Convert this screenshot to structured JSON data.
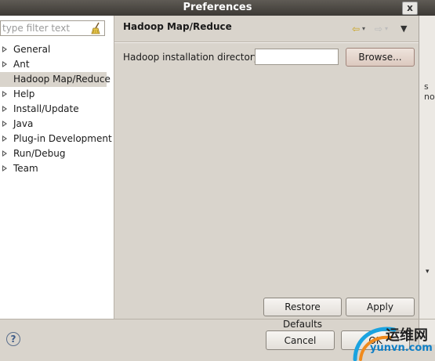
{
  "window": {
    "title": "Preferences",
    "close_label": "x"
  },
  "filter": {
    "placeholder": "type filter text"
  },
  "tree": {
    "items": [
      {
        "label": "General",
        "expandable": true,
        "selected": false
      },
      {
        "label": "Ant",
        "expandable": true,
        "selected": false
      },
      {
        "label": "Hadoop Map/Reduce",
        "expandable": false,
        "selected": true
      },
      {
        "label": "Help",
        "expandable": true,
        "selected": false
      },
      {
        "label": "Install/Update",
        "expandable": true,
        "selected": false
      },
      {
        "label": "Java",
        "expandable": true,
        "selected": false
      },
      {
        "label": "Plug-in Development",
        "expandable": true,
        "selected": false
      },
      {
        "label": "Run/Debug",
        "expandable": true,
        "selected": false
      },
      {
        "label": "Team",
        "expandable": true,
        "selected": false
      }
    ]
  },
  "page": {
    "title": "Hadoop Map/Reduce",
    "field_label": "Hadoop installation directory:",
    "field_value": "",
    "browse_label": "Browse...",
    "restore_label": "Restore Defaults",
    "apply_label": "Apply"
  },
  "footer": {
    "help_glyph": "?",
    "cancel_label": "Cancel",
    "ok_label": "OK"
  },
  "background_window": {
    "fragment": "s no"
  },
  "watermark": {
    "line1": "运维网",
    "line2": "yunvn.com"
  },
  "icons": [
    "close-icon",
    "clear-filter-icon",
    "back-icon",
    "forward-icon",
    "view-menu-icon",
    "help-icon"
  ],
  "colors": {
    "titlebar": "#4a4640",
    "dialog_bg": "#d9d4cc",
    "selection": "#d9d4cc",
    "help": "#3c5a87"
  }
}
